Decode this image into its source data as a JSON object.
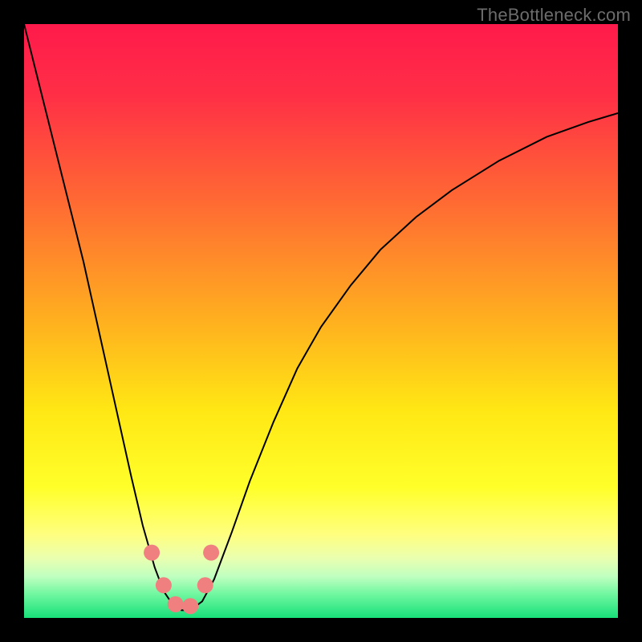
{
  "watermark": "TheBottleneck.com",
  "chart_data": {
    "type": "line",
    "title": "",
    "xlabel": "",
    "ylabel": "",
    "xlim": [
      0,
      100
    ],
    "ylim": [
      0,
      100
    ],
    "background_gradient": {
      "stops": [
        {
          "offset": 0.0,
          "color": "#ff1a4b"
        },
        {
          "offset": 0.12,
          "color": "#ff2f46"
        },
        {
          "offset": 0.3,
          "color": "#ff6a33"
        },
        {
          "offset": 0.5,
          "color": "#ffb01f"
        },
        {
          "offset": 0.65,
          "color": "#ffe714"
        },
        {
          "offset": 0.78,
          "color": "#ffff2a"
        },
        {
          "offset": 0.86,
          "color": "#ffff80"
        },
        {
          "offset": 0.9,
          "color": "#e9ffb0"
        },
        {
          "offset": 0.93,
          "color": "#c0ffc0"
        },
        {
          "offset": 0.96,
          "color": "#70f7a0"
        },
        {
          "offset": 1.0,
          "color": "#18e07a"
        }
      ]
    },
    "series": [
      {
        "name": "bottleneck-curve",
        "color": "#000000",
        "stroke_width": 2,
        "x": [
          0.0,
          2.0,
          4.0,
          6.0,
          8.0,
          10.0,
          12.0,
          14.0,
          16.0,
          18.0,
          20.0,
          22.0,
          23.5,
          25.0,
          26.5,
          28.0,
          30.0,
          32.0,
          35.0,
          38.0,
          42.0,
          46.0,
          50.0,
          55.0,
          60.0,
          66.0,
          72.0,
          80.0,
          88.0,
          95.0,
          100.0
        ],
        "y": [
          100.0,
          92.0,
          84.0,
          76.0,
          68.0,
          60.0,
          51.0,
          42.0,
          33.0,
          24.0,
          15.5,
          8.5,
          4.5,
          2.3,
          1.3,
          1.3,
          2.8,
          6.5,
          14.5,
          23.0,
          33.0,
          42.0,
          49.0,
          56.0,
          62.0,
          67.5,
          72.0,
          77.0,
          81.0,
          83.5,
          85.0
        ]
      }
    ],
    "markers": {
      "name": "highlight-points",
      "color": "#f08080",
      "radius": 10,
      "points": [
        {
          "x": 21.5,
          "y": 11.0
        },
        {
          "x": 23.5,
          "y": 5.5
        },
        {
          "x": 25.5,
          "y": 2.3
        },
        {
          "x": 28.0,
          "y": 2.0
        },
        {
          "x": 30.5,
          "y": 5.5
        },
        {
          "x": 31.5,
          "y": 11.0
        }
      ]
    }
  }
}
